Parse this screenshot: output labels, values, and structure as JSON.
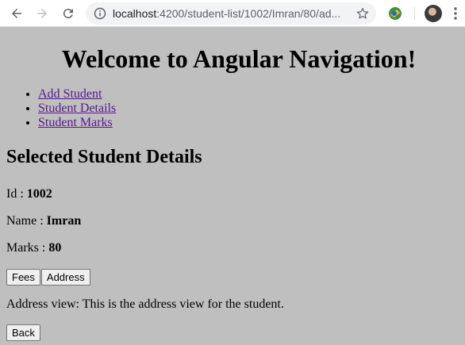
{
  "browser": {
    "url_host": "localhost",
    "url_path": ":4200/student-list/1002/Imran/80/ad..."
  },
  "header": {
    "title": "Welcome to Angular Navigation!"
  },
  "nav": {
    "items": [
      "Add Student",
      "Student Details",
      "Student Marks"
    ]
  },
  "details": {
    "heading": "Selected Student Details",
    "id_label": "Id : ",
    "id_value": "1002",
    "name_label": "Name : ",
    "name_value": "Imran",
    "marks_label": "Marks : ",
    "marks_value": "80"
  },
  "buttons": {
    "fees": "Fees",
    "address": "Address",
    "back": "Back"
  },
  "address_view": {
    "text": "Address view: This is the address view for the student."
  }
}
